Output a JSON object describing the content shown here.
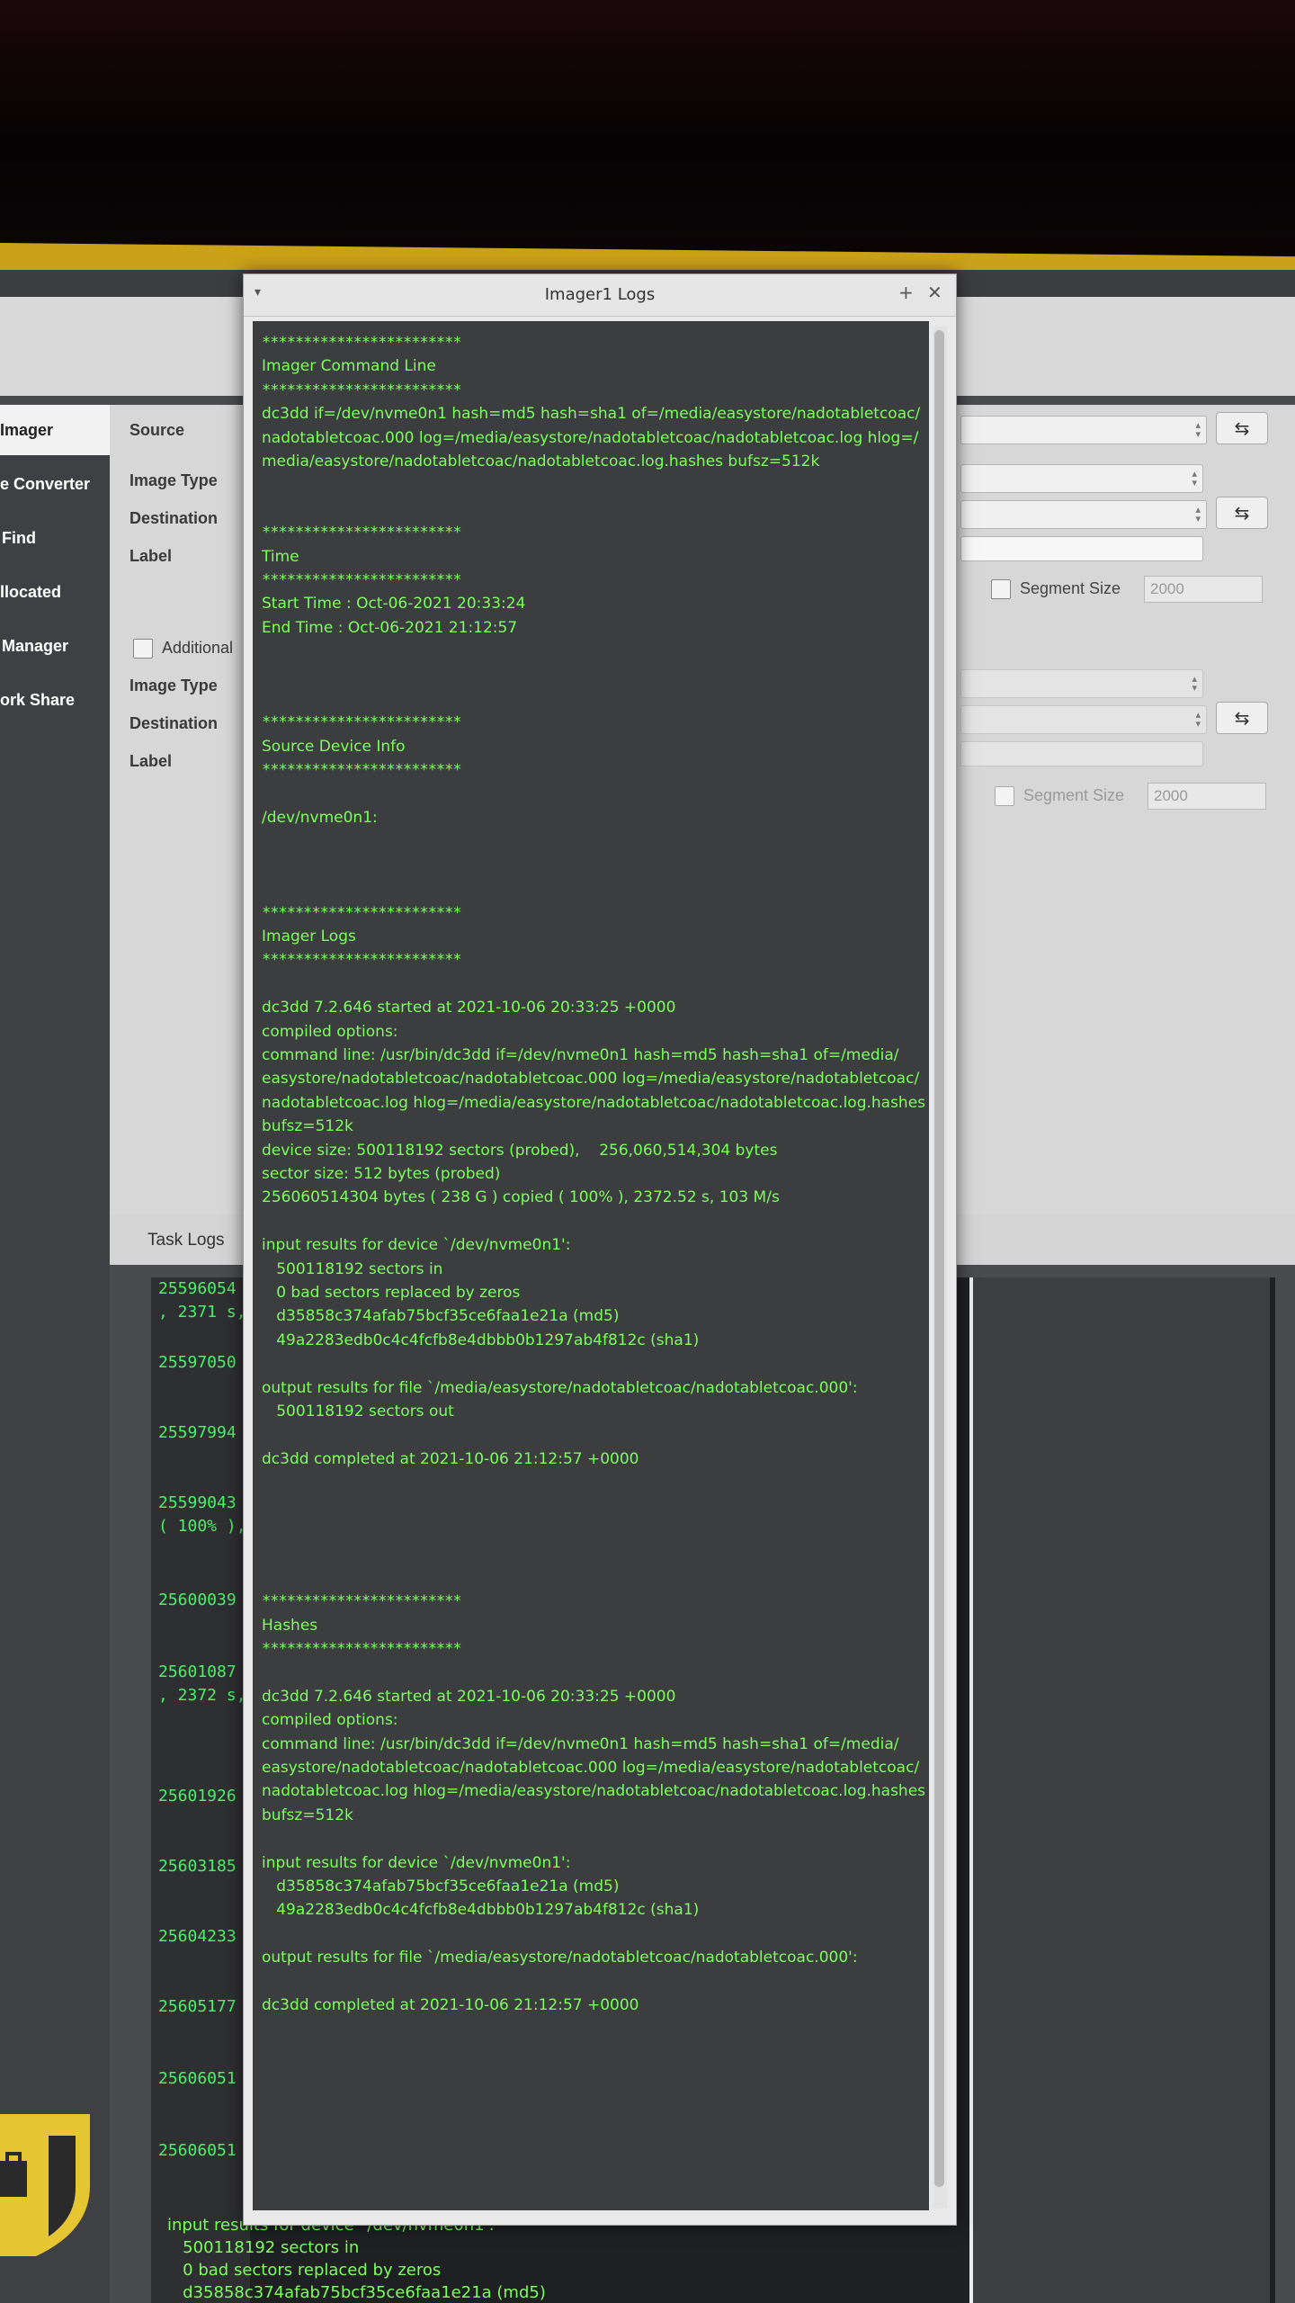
{
  "log_window": {
    "title": "Imager1 Logs",
    "lines": [
      "************************",
      "Imager Command Line",
      "************************",
      "dc3dd if=/dev/nvme0n1 hash=md5 hash=sha1 of=/media/easystore/nadotabletcoac/",
      "nadotabletcoac.000 log=/media/easystore/nadotabletcoac/nadotabletcoac.log hlog=/",
      "media/easystore/nadotabletcoac/nadotabletcoac.log.hashes bufsz=512k",
      "",
      "",
      "************************",
      "Time",
      "************************",
      "Start Time : Oct-06-2021 20:33:24",
      "End Time : Oct-06-2021 21:12:57",
      "",
      "",
      "",
      "************************",
      "Source Device Info",
      "************************",
      "",
      "/dev/nvme0n1:",
      "",
      "",
      "",
      "************************",
      "Imager Logs",
      "************************",
      "",
      "dc3dd 7.2.646 started at 2021-10-06 20:33:25 +0000",
      "compiled options:",
      "command line: /usr/bin/dc3dd if=/dev/nvme0n1 hash=md5 hash=sha1 of=/media/",
      "easystore/nadotabletcoac/nadotabletcoac.000 log=/media/easystore/nadotabletcoac/",
      "nadotabletcoac.log hlog=/media/easystore/nadotabletcoac/nadotabletcoac.log.hashes",
      "bufsz=512k",
      "device size: 500118192 sectors (probed),    256,060,514,304 bytes",
      "sector size: 512 bytes (probed)",
      "256060514304 bytes ( 238 G ) copied ( 100% ), 2372.52 s, 103 M/s",
      "",
      "input results for device `/dev/nvme0n1':",
      "   500118192 sectors in",
      "   0 bad sectors replaced by zeros",
      "   d35858c374afab75bcf35ce6faa1e21a (md5)",
      "   49a2283edb0c4c4fcfb8e4dbbb0b1297ab4f812c (sha1)",
      "",
      "output results for file `/media/easystore/nadotabletcoac/nadotabletcoac.000':",
      "   500118192 sectors out",
      "",
      "dc3dd completed at 2021-10-06 21:12:57 +0000",
      "",
      "",
      "",
      "",
      "",
      "************************",
      "Hashes",
      "************************",
      "",
      "dc3dd 7.2.646 started at 2021-10-06 20:33:25 +0000",
      "compiled options:",
      "command line: /usr/bin/dc3dd if=/dev/nvme0n1 hash=md5 hash=sha1 of=/media/",
      "easystore/nadotabletcoac/nadotabletcoac.000 log=/media/easystore/nadotabletcoac/",
      "nadotabletcoac.log hlog=/media/easystore/nadotabletcoac/nadotabletcoac.log.hashes",
      "bufsz=512k",
      "",
      "input results for device `/dev/nvme0n1':",
      "   d35858c374afab75bcf35ce6faa1e21a (md5)",
      "   49a2283edb0c4c4fcfb8e4dbbb0b1297ab4f812c (sha1)",
      "",
      "output results for file `/media/easystore/nadotabletcoac/nadotabletcoac.000':",
      "",
      "dc3dd completed at 2021-10-06 21:12:57 +0000"
    ]
  },
  "sidebar": {
    "items": [
      {
        "label": "Imager"
      },
      {
        "label": "e Converter"
      },
      {
        "label": "Find"
      },
      {
        "label": "llocated"
      },
      {
        "label": "Manager"
      },
      {
        "label": "ork Share"
      }
    ]
  },
  "form": {
    "source_label": "Source",
    "image_type_label": "Image Type",
    "destination_label": "Destination",
    "label_label": "Label",
    "additional_label": "Additional",
    "image_type_label_2": "Image Type",
    "destination_label_2": "Destination",
    "label_label_2": "Label",
    "segment_size_label": "Segment Size",
    "segment_size_value": "2000",
    "segment_size_label_2": "Segment Size",
    "segment_size_value_2": "2000"
  },
  "task_logs": {
    "tab_label": "Task Logs",
    "numbers": [
      "25596054",
      ", 2371 s, 10",
      "25597050",
      "25597994",
      "25599043",
      "( 100% ), 2",
      "25600039",
      "25601087",
      ", 2372 s, 10",
      "25601926",
      "25603185",
      "25604233",
      "25605177",
      "25606051",
      "25606051"
    ]
  },
  "bottom_log": {
    "lines": [
      "input results for device `/dev/nvme0n1':",
      "   500118192 sectors in",
      "   0 bad sectors replaced by zeros",
      "   d35858c374afab75bcf35ce6faa1e21a (md5)"
    ]
  },
  "colors": {
    "log_text": "#7cff5c",
    "log_bg": "#3b3d3f",
    "accent_yellow": "#c9a21a"
  }
}
